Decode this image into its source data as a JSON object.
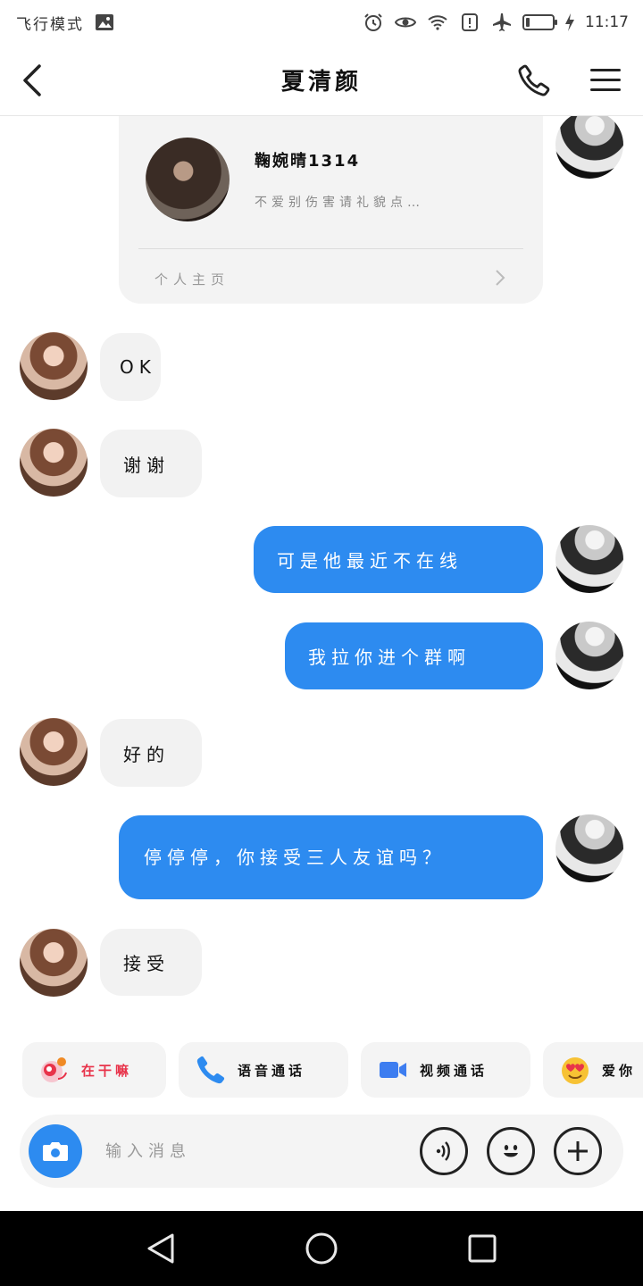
{
  "status_bar": {
    "left_text": "飞行模式",
    "time": "11:17",
    "battery_level": 0.15,
    "icons": [
      "image-icon",
      "alarm-icon",
      "eye-icon",
      "wifi-icon",
      "alert-icon",
      "airplane-icon",
      "battery-icon",
      "charging-icon"
    ]
  },
  "header": {
    "title": "夏清颜"
  },
  "card": {
    "name": "鞠婉晴1314",
    "bio": "不爱别伤害请礼貌点…",
    "footer_label": "个人主页"
  },
  "messages": [
    {
      "side": "in",
      "text": "OK"
    },
    {
      "side": "in",
      "text": "谢谢"
    },
    {
      "side": "out",
      "text": "可是他最近不在线"
    },
    {
      "side": "out",
      "text": "我拉你进个群啊"
    },
    {
      "side": "in",
      "text": "好的"
    },
    {
      "side": "out",
      "text": "停停停，你接受三人友谊吗？"
    },
    {
      "side": "in",
      "text": "接受"
    }
  ],
  "quick_actions": [
    {
      "label": "在干嘛",
      "icon": "wave-icon",
      "color": "#e8334a"
    },
    {
      "label": "语音通话",
      "icon": "phone-icon",
      "color": "#2d8bf0"
    },
    {
      "label": "视频通话",
      "icon": "video-icon",
      "color": "#2d8bf0"
    },
    {
      "label": "爱你",
      "icon": "heart-eyes-icon",
      "color": "#f5b400"
    }
  ],
  "input": {
    "placeholder": "输入消息"
  },
  "colors": {
    "accent": "#2d8bf0",
    "bubble_in": "#f2f2f2",
    "bubble_out": "#2d8bf0"
  }
}
